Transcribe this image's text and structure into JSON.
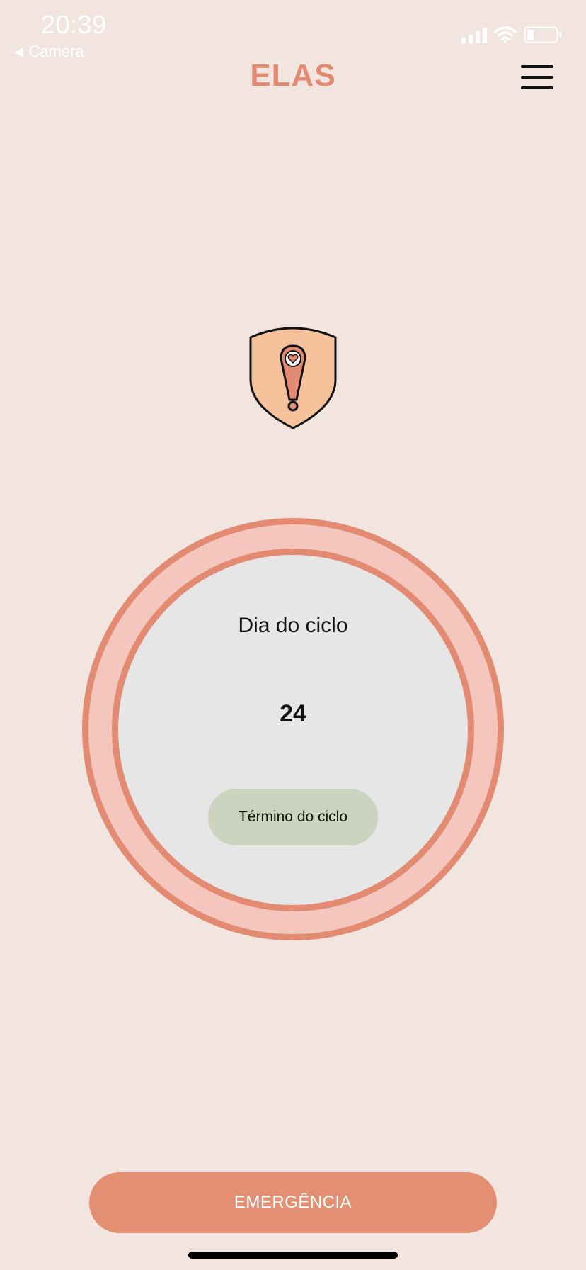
{
  "status_bar": {
    "time": "20:39",
    "back_app_label": "Camera",
    "icons": [
      "back-arrow-icon",
      "cellular-signal-icon",
      "wifi-icon",
      "battery-icon"
    ]
  },
  "header": {
    "title": "ELAS",
    "menu_icon": "hamburger-menu-icon"
  },
  "hero_icon": "shield-alert-icon",
  "cycle": {
    "label": "Dia do ciclo",
    "day": "24",
    "end_button_label": "Término do ciclo"
  },
  "emergency": {
    "label": "EMERGÊNCIA"
  },
  "colors": {
    "background": "#F2E5DF",
    "accent": "#E38B72",
    "ring_fill": "#F4C6BD",
    "inner_fill": "#E6E6E6",
    "end_button": "#CCD4BF",
    "shield_fill": "#F6C29C"
  }
}
